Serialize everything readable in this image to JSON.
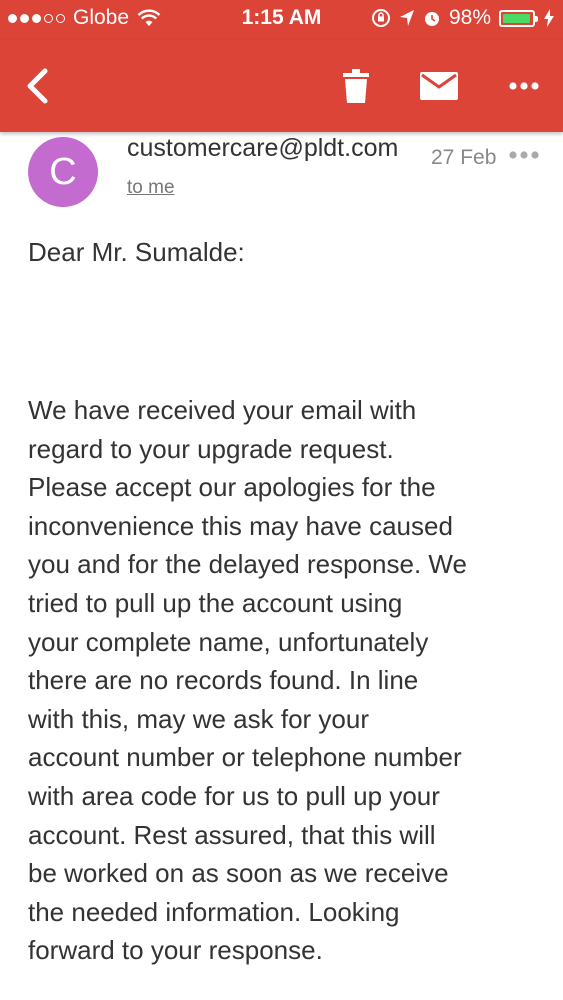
{
  "status_bar": {
    "carrier": "Globe",
    "time": "1:15 AM",
    "battery": "98%",
    "battery_level": 0.98,
    "signal_bars_filled": 3,
    "signal_bars_total": 5
  },
  "toolbar": {
    "back_icon": "chevron-left-icon",
    "delete_icon": "trash-icon",
    "mark_icon": "envelope-icon",
    "more_icon": "more-horizontal-icon"
  },
  "email": {
    "avatar_letter": "C",
    "avatar_color": "#c36bcf",
    "sender": "customercare@pldt.com",
    "recipient": "to me",
    "date": "27 Feb",
    "greeting": "Dear Mr. Sumalde:",
    "body": "We have received your email with\nregard to your upgrade request.\nPlease accept our apologies for the\ninconvenience this may have caused\nyou and for the delayed response. We\ntried to pull up the account using\nyour complete name, unfortunately\nthere are no records found. In line\nwith this, may we ask for your\naccount number or telephone number\nwith area code for us to pull up your\naccount. Rest assured, that this will\nbe worked on as soon as we receive\nthe needed information. Looking\nforward to your response."
  },
  "colors": {
    "brand_red": "#db4437",
    "battery_green": "#4cd964"
  }
}
